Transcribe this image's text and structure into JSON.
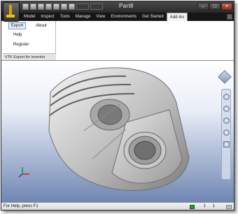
{
  "window": {
    "title": "Part8"
  },
  "tabs": [
    {
      "label": "Model"
    },
    {
      "label": "Inspect"
    },
    {
      "label": "Tools"
    },
    {
      "label": "Manage"
    },
    {
      "label": "View"
    },
    {
      "label": "Environments"
    },
    {
      "label": "Get Started"
    },
    {
      "label": "Add-Ins",
      "active": true
    }
  ],
  "ribbon": {
    "buttons": {
      "export": "Export",
      "about": "About",
      "help": "Help",
      "register": "Register"
    },
    "panel_label": "VTK Export for Inventor"
  },
  "statusbar": {
    "text": "For Help, press F1",
    "num1": "1",
    "num2": "1"
  },
  "colors": {
    "viewport_top": "#ffffff",
    "viewport_bottom": "#6f86b2",
    "active_button": "#6b9bd1",
    "status_indicator": "#1aa32a"
  }
}
